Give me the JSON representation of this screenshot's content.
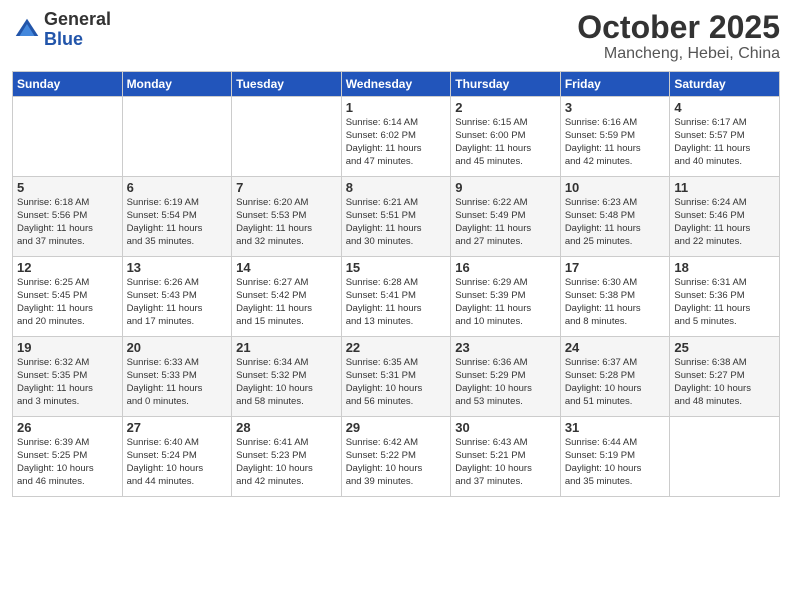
{
  "header": {
    "logo_general": "General",
    "logo_blue": "Blue",
    "month_title": "October 2025",
    "location": "Mancheng, Hebei, China"
  },
  "calendar": {
    "day_headers": [
      "Sunday",
      "Monday",
      "Tuesday",
      "Wednesday",
      "Thursday",
      "Friday",
      "Saturday"
    ],
    "weeks": [
      [
        {
          "day": "",
          "info": ""
        },
        {
          "day": "",
          "info": ""
        },
        {
          "day": "",
          "info": ""
        },
        {
          "day": "1",
          "info": "Sunrise: 6:14 AM\nSunset: 6:02 PM\nDaylight: 11 hours\nand 47 minutes."
        },
        {
          "day": "2",
          "info": "Sunrise: 6:15 AM\nSunset: 6:00 PM\nDaylight: 11 hours\nand 45 minutes."
        },
        {
          "day": "3",
          "info": "Sunrise: 6:16 AM\nSunset: 5:59 PM\nDaylight: 11 hours\nand 42 minutes."
        },
        {
          "day": "4",
          "info": "Sunrise: 6:17 AM\nSunset: 5:57 PM\nDaylight: 11 hours\nand 40 minutes."
        }
      ],
      [
        {
          "day": "5",
          "info": "Sunrise: 6:18 AM\nSunset: 5:56 PM\nDaylight: 11 hours\nand 37 minutes."
        },
        {
          "day": "6",
          "info": "Sunrise: 6:19 AM\nSunset: 5:54 PM\nDaylight: 11 hours\nand 35 minutes."
        },
        {
          "day": "7",
          "info": "Sunrise: 6:20 AM\nSunset: 5:53 PM\nDaylight: 11 hours\nand 32 minutes."
        },
        {
          "day": "8",
          "info": "Sunrise: 6:21 AM\nSunset: 5:51 PM\nDaylight: 11 hours\nand 30 minutes."
        },
        {
          "day": "9",
          "info": "Sunrise: 6:22 AM\nSunset: 5:49 PM\nDaylight: 11 hours\nand 27 minutes."
        },
        {
          "day": "10",
          "info": "Sunrise: 6:23 AM\nSunset: 5:48 PM\nDaylight: 11 hours\nand 25 minutes."
        },
        {
          "day": "11",
          "info": "Sunrise: 6:24 AM\nSunset: 5:46 PM\nDaylight: 11 hours\nand 22 minutes."
        }
      ],
      [
        {
          "day": "12",
          "info": "Sunrise: 6:25 AM\nSunset: 5:45 PM\nDaylight: 11 hours\nand 20 minutes."
        },
        {
          "day": "13",
          "info": "Sunrise: 6:26 AM\nSunset: 5:43 PM\nDaylight: 11 hours\nand 17 minutes."
        },
        {
          "day": "14",
          "info": "Sunrise: 6:27 AM\nSunset: 5:42 PM\nDaylight: 11 hours\nand 15 minutes."
        },
        {
          "day": "15",
          "info": "Sunrise: 6:28 AM\nSunset: 5:41 PM\nDaylight: 11 hours\nand 13 minutes."
        },
        {
          "day": "16",
          "info": "Sunrise: 6:29 AM\nSunset: 5:39 PM\nDaylight: 11 hours\nand 10 minutes."
        },
        {
          "day": "17",
          "info": "Sunrise: 6:30 AM\nSunset: 5:38 PM\nDaylight: 11 hours\nand 8 minutes."
        },
        {
          "day": "18",
          "info": "Sunrise: 6:31 AM\nSunset: 5:36 PM\nDaylight: 11 hours\nand 5 minutes."
        }
      ],
      [
        {
          "day": "19",
          "info": "Sunrise: 6:32 AM\nSunset: 5:35 PM\nDaylight: 11 hours\nand 3 minutes."
        },
        {
          "day": "20",
          "info": "Sunrise: 6:33 AM\nSunset: 5:33 PM\nDaylight: 11 hours\nand 0 minutes."
        },
        {
          "day": "21",
          "info": "Sunrise: 6:34 AM\nSunset: 5:32 PM\nDaylight: 10 hours\nand 58 minutes."
        },
        {
          "day": "22",
          "info": "Sunrise: 6:35 AM\nSunset: 5:31 PM\nDaylight: 10 hours\nand 56 minutes."
        },
        {
          "day": "23",
          "info": "Sunrise: 6:36 AM\nSunset: 5:29 PM\nDaylight: 10 hours\nand 53 minutes."
        },
        {
          "day": "24",
          "info": "Sunrise: 6:37 AM\nSunset: 5:28 PM\nDaylight: 10 hours\nand 51 minutes."
        },
        {
          "day": "25",
          "info": "Sunrise: 6:38 AM\nSunset: 5:27 PM\nDaylight: 10 hours\nand 48 minutes."
        }
      ],
      [
        {
          "day": "26",
          "info": "Sunrise: 6:39 AM\nSunset: 5:25 PM\nDaylight: 10 hours\nand 46 minutes."
        },
        {
          "day": "27",
          "info": "Sunrise: 6:40 AM\nSunset: 5:24 PM\nDaylight: 10 hours\nand 44 minutes."
        },
        {
          "day": "28",
          "info": "Sunrise: 6:41 AM\nSunset: 5:23 PM\nDaylight: 10 hours\nand 42 minutes."
        },
        {
          "day": "29",
          "info": "Sunrise: 6:42 AM\nSunset: 5:22 PM\nDaylight: 10 hours\nand 39 minutes."
        },
        {
          "day": "30",
          "info": "Sunrise: 6:43 AM\nSunset: 5:21 PM\nDaylight: 10 hours\nand 37 minutes."
        },
        {
          "day": "31",
          "info": "Sunrise: 6:44 AM\nSunset: 5:19 PM\nDaylight: 10 hours\nand 35 minutes."
        },
        {
          "day": "",
          "info": ""
        }
      ]
    ]
  }
}
